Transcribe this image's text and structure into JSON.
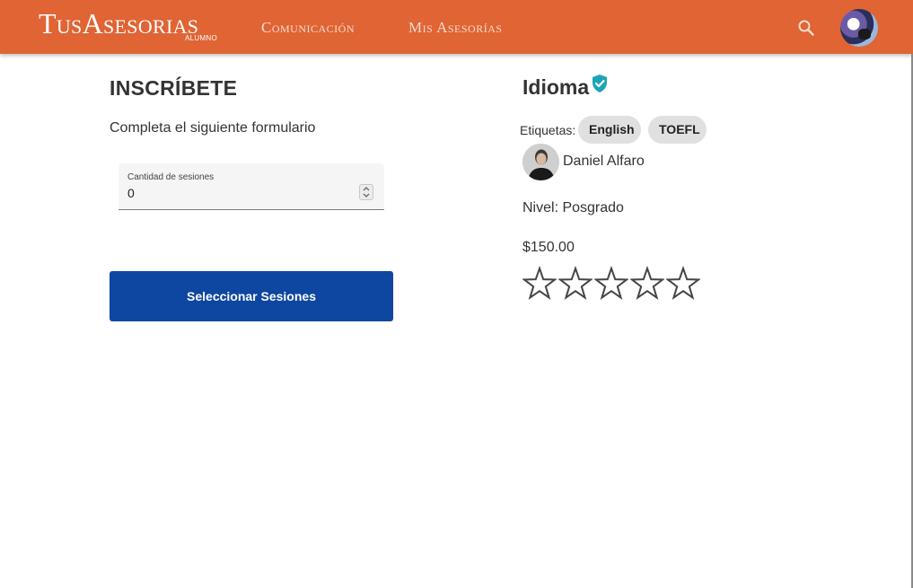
{
  "header": {
    "brand": "TusAsesorias",
    "brand_sub": "ALUMNO",
    "nav": [
      {
        "label": "Comunicación"
      },
      {
        "label": "Mis Asesorías"
      }
    ],
    "search_icon": "search-icon",
    "avatar_icon": "user-avatar"
  },
  "form": {
    "title": "INSCRÍBETE",
    "subtitle": "Completa el siguiente formulario",
    "field_label": "Cantidad de sesiones",
    "field_value": "0",
    "submit_label": "Seleccionar Sesiones"
  },
  "course": {
    "title": "Idioma",
    "verified_icon": "verified-shield-icon",
    "tags_label": "Etiquetas:",
    "tags": [
      "English",
      "TOEFL"
    ],
    "tutor_name": "Daniel Alfaro",
    "level": "Nivel: Posgrado",
    "price": "$150.00",
    "rating": 0,
    "rating_max": 5
  },
  "colors": {
    "header_bg": "#e06434",
    "button_bg": "#0d47a1",
    "verified": "#1aa5b8",
    "chip_bg": "#e0e0e0"
  }
}
